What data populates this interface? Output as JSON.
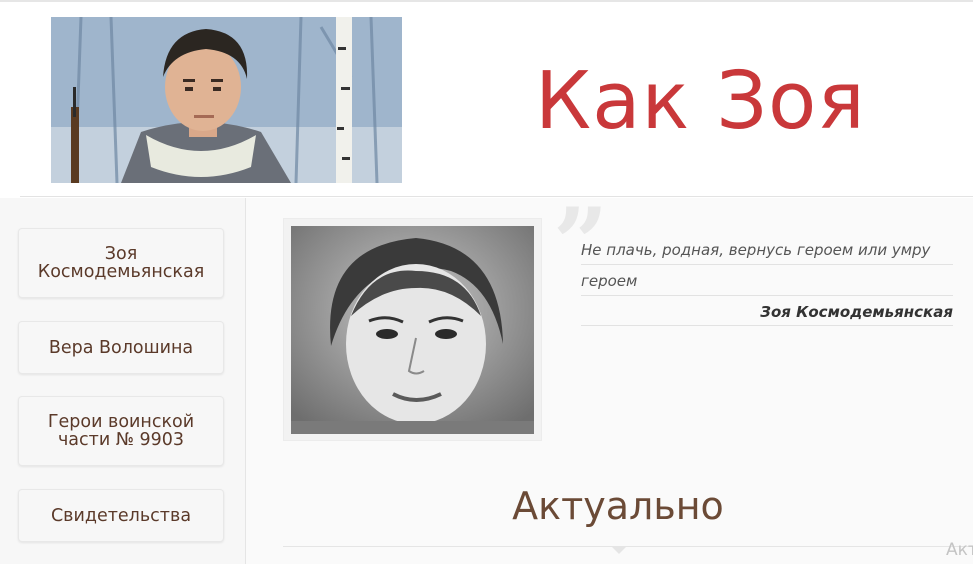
{
  "header": {
    "site_title": "Как Зоя",
    "logo_painting_alt": "painting-portrait"
  },
  "sidebar": {
    "items": [
      {
        "label": "Зоя Космодемьянская"
      },
      {
        "label": "Вера Волошина"
      },
      {
        "label": "Герои воинской части № 9903"
      },
      {
        "label": "Свидетельства"
      }
    ]
  },
  "quote": {
    "line1": "Не плачь, родная, вернусь героем или умру",
    "line2": "героем",
    "author": "Зоя Космодемьянская"
  },
  "section": {
    "title": "Актуально",
    "cut_text": "Акт"
  },
  "colors": {
    "title_red": "#c9383a",
    "nav_text_brown": "#5b3a2a",
    "section_brown": "#6b4a36"
  }
}
